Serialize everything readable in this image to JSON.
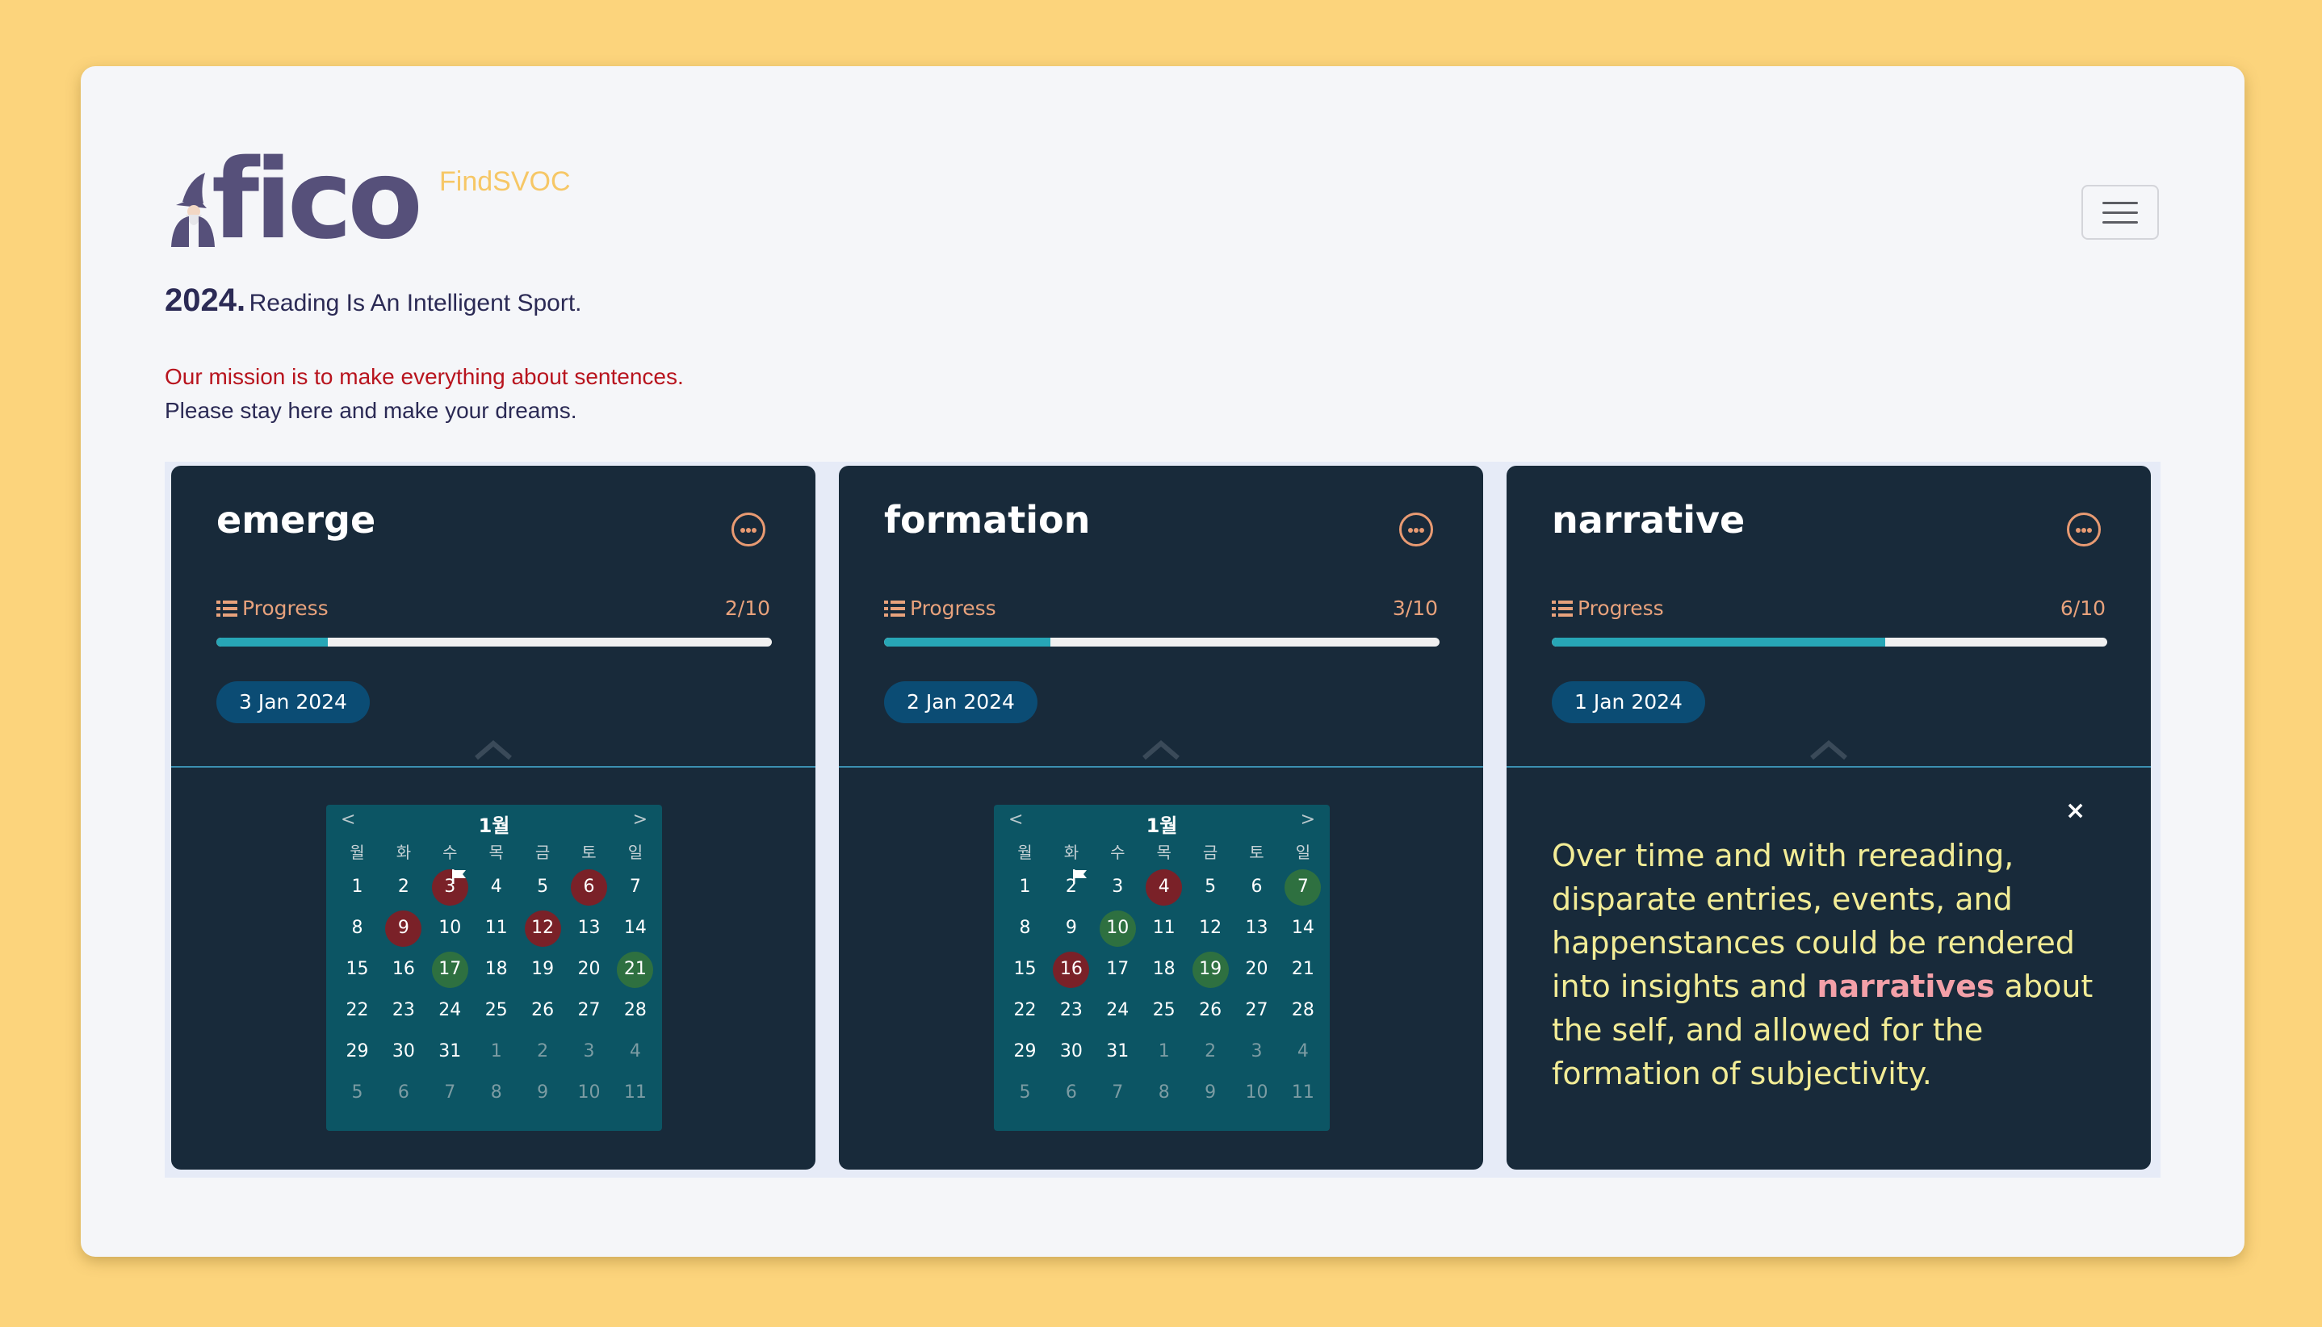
{
  "header": {
    "logo_text": "fico",
    "logo_subtitle": "FindSVOC",
    "menu_aria": "menu-icon"
  },
  "tagline": {
    "year": "2024.",
    "motto": "Reading Is An Intelligent Sport."
  },
  "mission": {
    "line1": "Our mission is to make everything about sentences.",
    "line2": "Please stay here and make your dreams."
  },
  "colors": {
    "background": "#fcd47c",
    "card": "#182a3a",
    "progress_fill": "#27a6b6",
    "accent": "#e8a27c",
    "marked_red": "#7a2128",
    "marked_green": "#2e7040"
  },
  "calendar": {
    "weekdays": [
      "월",
      "화",
      "수",
      "목",
      "금",
      "토",
      "일"
    ],
    "prev": "<",
    "next": ">"
  },
  "cards": [
    {
      "title": "emerge",
      "progress_label": "Progress",
      "progress_count": "2/10",
      "progress_fraction": 0.2,
      "date": "3 Jan 2024",
      "month": "1월",
      "flag_day": 3,
      "red_days": [
        3,
        6,
        9,
        12
      ],
      "green_days": [
        17,
        21
      ]
    },
    {
      "title": "formation",
      "progress_label": "Progress",
      "progress_count": "3/10",
      "progress_fraction": 0.3,
      "date": "2 Jan 2024",
      "month": "1월",
      "flag_day": 2,
      "red_days": [
        4,
        16
      ],
      "green_days": [
        7,
        10,
        19
      ]
    },
    {
      "title": "narrative",
      "progress_label": "Progress",
      "progress_count": "6/10",
      "progress_fraction": 0.6,
      "date": "1 Jan 2024",
      "close": "×",
      "text_before": "Over time and with rereading, disparate entries, events, and happenstances could be rendered into insights and ",
      "text_highlight": "narratives",
      "text_after": " about the self, and allowed for the formation of subjectivity."
    }
  ]
}
